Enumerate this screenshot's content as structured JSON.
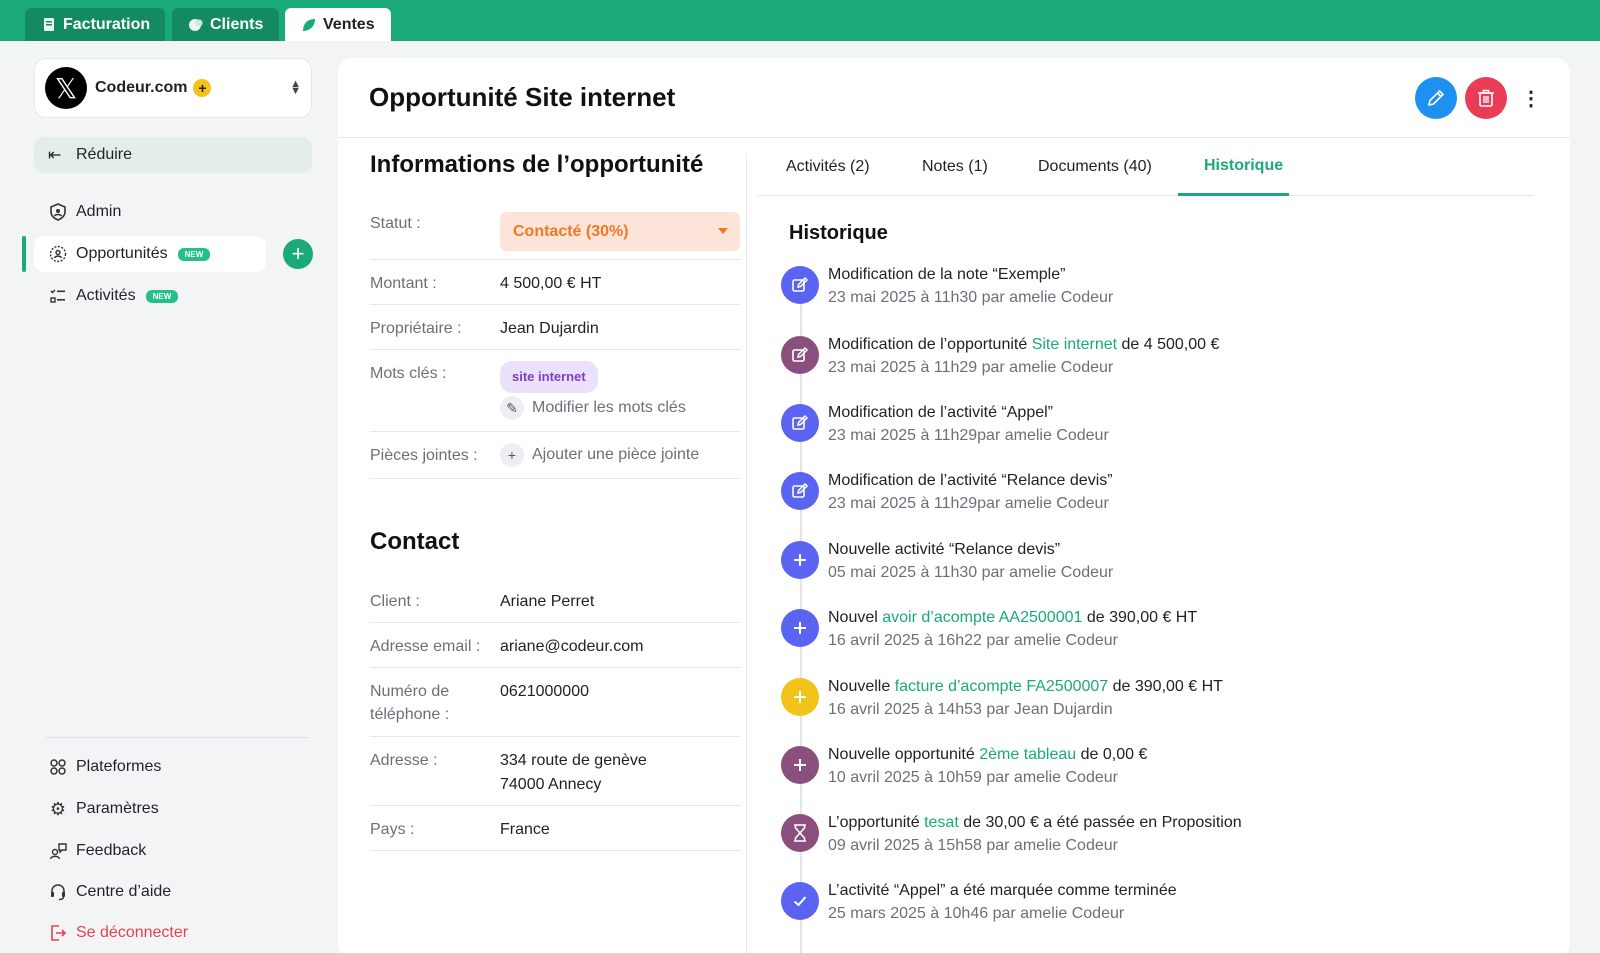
{
  "tabs": [
    {
      "label": "Facturation",
      "icon": "receipt-icon"
    },
    {
      "label": "Clients",
      "icon": "clients-icon"
    },
    {
      "label": "Ventes",
      "icon": "leaf-icon",
      "active": true
    }
  ],
  "org": {
    "logo": "𝕏",
    "name": "Codeur.com",
    "badge": "+"
  },
  "sidebar": {
    "reduce": "Réduire",
    "items": [
      {
        "label": "Admin",
        "icon": "shield-icon"
      },
      {
        "label": "Opportunités",
        "icon": "opportunities-icon",
        "badge": "NEW",
        "selected": true
      },
      {
        "label": "Activités",
        "icon": "checklist-icon",
        "badge": "NEW"
      }
    ],
    "bottom": [
      {
        "label": "Plateformes",
        "icon": "grid-icon"
      },
      {
        "label": "Paramètres",
        "icon": "gear-icon"
      },
      {
        "label": "Feedback",
        "icon": "feedback-icon"
      },
      {
        "label": "Centre d’aide",
        "icon": "headset-icon"
      },
      {
        "label": "Se déconnecter",
        "icon": "logout-icon"
      }
    ]
  },
  "page": {
    "title": "Opportunité Site internet"
  },
  "info": {
    "title": "Informations de l’opportunité",
    "statut_label": "Statut :",
    "statut_value": "Contacté (30%)",
    "montant_label": "Montant :",
    "montant_value": "4 500,00 € HT",
    "proprietaire_label": "Propriétaire :",
    "proprietaire_value": "Jean Dujardin",
    "mots_label": "Mots clés :",
    "tag": "site internet",
    "modifier_mots": "Modifier les mots clés",
    "pieces_label": "Pièces jointes :",
    "ajouter_piece": "Ajouter une pièce jointe"
  },
  "contact": {
    "title": "Contact",
    "client_label": "Client :",
    "client_value": "Ariane Perret",
    "email_label": "Adresse email :",
    "email_value": "ariane@codeur.com",
    "tel_label_1": "Numéro de",
    "tel_label_2": "téléphone :",
    "tel_value": "0621000000",
    "adresse_label": "Adresse :",
    "adresse_1": "334 route de genève",
    "adresse_2": "74000 Annecy",
    "pays_label": "Pays :",
    "pays_value": "France"
  },
  "rtabs": [
    "Activités (2)",
    "Notes (1)",
    "Documents (40)",
    "Historique"
  ],
  "history": {
    "title": "Historique",
    "items": [
      {
        "pre": "Modification de la note “Exemple”",
        "link": "",
        "post": "",
        "meta": "23 mai 2025 à 11h30 par amelie Codeur",
        "color": "#5b63f2",
        "icon": "edit-icon"
      },
      {
        "pre": "Modification de l’opportunité ",
        "link": "Site internet",
        "post": " de 4 500,00 €",
        "meta": "23 mai 2025 à 11h29 par amelie Codeur",
        "color": "#8a4f7d",
        "icon": "edit-icon"
      },
      {
        "pre": "Modification de l’activité “Appel”",
        "link": "",
        "post": "",
        "meta": "23 mai 2025 à 11h29par amelie Codeur",
        "color": "#5b63f2",
        "icon": "edit-icon"
      },
      {
        "pre": "Modification de l’activité “Relance devis”",
        "link": "",
        "post": "",
        "meta": "23 mai 2025 à 11h29par amelie Codeur",
        "color": "#5b63f2",
        "icon": "edit-icon"
      },
      {
        "pre": "Nouvelle activité “Relance devis”",
        "link": "",
        "post": "",
        "meta": "05 mai 2025 à 11h30 par amelie Codeur",
        "color": "#5b63f2",
        "icon": "plus-icon"
      },
      {
        "pre": "Nouvel ",
        "link": "avoir d’acompte AA2500001",
        "post": " de 390,00 € HT",
        "meta": "16 avril 2025 à 16h22 par amelie Codeur",
        "color": "#5b63f2",
        "icon": "plus-icon"
      },
      {
        "pre": "Nouvelle ",
        "link": "facture d’acompte FA2500007",
        "post": " de 390,00 € HT",
        "meta": "16 avril 2025 à 14h53 par Jean Dujardin",
        "color": "#f2c318",
        "icon": "plus-icon"
      },
      {
        "pre": "Nouvelle opportunité ",
        "link": "2ème tableau",
        "post": " de 0,00 €",
        "meta": "10 avril 2025 à 10h59 par amelie Codeur",
        "color": "#8a4f7d",
        "icon": "plus-icon"
      },
      {
        "pre": "L’opportunité ",
        "link": "tesat",
        "post": " de 30,00 € a été passée en Proposition",
        "meta": "09 avril 2025 à 15h58 par amelie Codeur",
        "color": "#8a4f7d",
        "icon": "hourglass-icon"
      },
      {
        "pre": "L’activité “Appel” a été marquée comme terminée",
        "link": "",
        "post": "",
        "meta": "25 mars 2025 à 10h46 par amelie Codeur",
        "color": "#5b63f2",
        "icon": "check-icon"
      }
    ]
  }
}
